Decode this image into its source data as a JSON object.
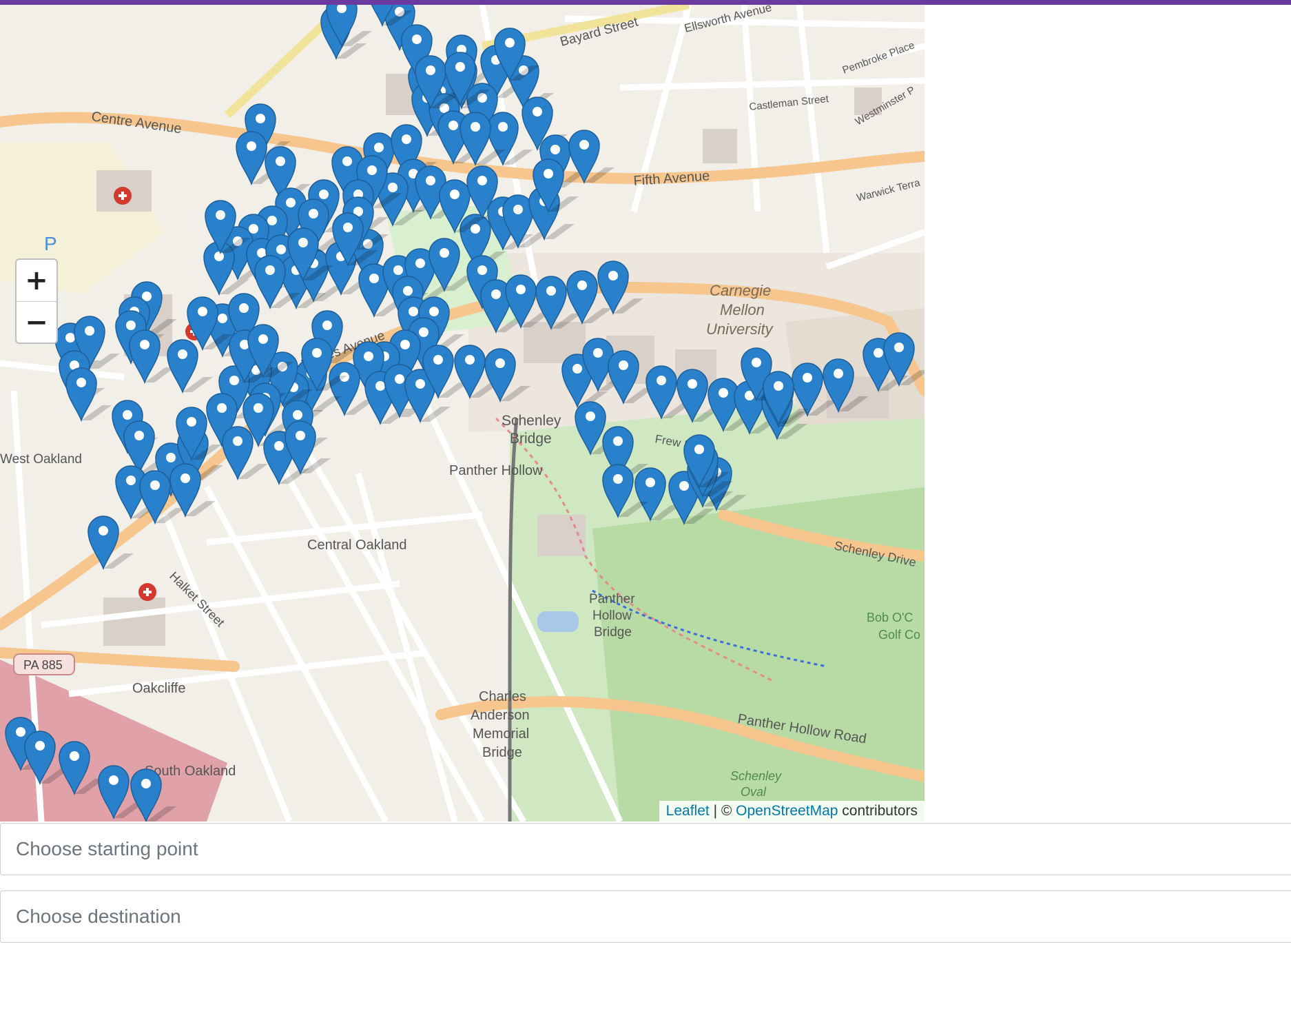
{
  "colors": {
    "accent_bar": "#6a3aa0",
    "marker": "#2a81cb",
    "link": "#0078a8"
  },
  "map": {
    "zoom_in_label": "+",
    "zoom_out_label": "−",
    "attribution": {
      "leaflet": "Leaflet",
      "separator": " | © ",
      "osm": "OpenStreetMap",
      "suffix": " contributors"
    },
    "labels": {
      "fifth_avenue": "Fifth Avenue",
      "bayard_street": "Bayard Street",
      "ellsworth_avenue": "Ellsworth Avenue",
      "centre_avenue": "Centre Avenue",
      "forbes_avenue": "Forbes Avenue",
      "cmu_1": "Carnegie",
      "cmu_2": "Mellon",
      "cmu_3": "University",
      "schenley_bridge_1": "Schenley",
      "schenley_bridge_2": "Bridge",
      "panther_hollow": "Panther Hollow",
      "central_oakland": "Central Oakland",
      "west_oakland": "West Oakland",
      "south_oakland": "South Oakland",
      "oakcliffe": "Oakcliffe",
      "pa885": "PA 885",
      "panther_hollow_road": "Panther Hollow Road",
      "schenley_drive": "Schenley Drive",
      "phh_bridge_1": "Panther",
      "phh_bridge_2": "Hollow",
      "phh_bridge_3": "Bridge",
      "charles_1": "Charles",
      "charles_2": "Anderson",
      "charles_3": "Memorial",
      "charles_4": "Bridge",
      "schenley_oval_1": "Schenley",
      "schenley_oval_2": "Oval",
      "bob_oc": "Bob O'C",
      "golf": "Golf Co",
      "halket_street": "Halket Street",
      "frew_street": "Frew Stre",
      "warwick": "Warwick Terra",
      "pembroke": "Pembroke Place",
      "castleman": "Castleman Street",
      "westminster": "Westminster P",
      "parking": "P"
    },
    "markers_visible": true
  },
  "start": {
    "placeholder": "Choose starting point",
    "value": ""
  },
  "destination": {
    "placeholder": "Choose destination",
    "value": ""
  }
}
